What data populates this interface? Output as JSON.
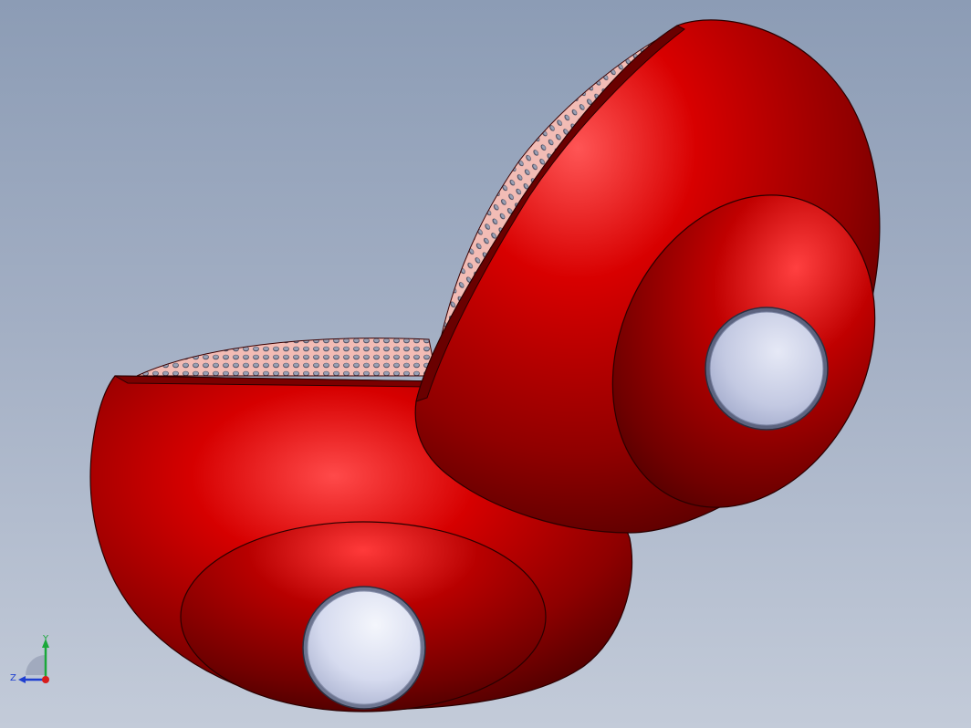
{
  "viewport": {
    "title": "",
    "background_top": "#8c9cb5",
    "background_bottom": "#c3cbd9"
  },
  "model": {
    "part_color": "#c40000",
    "perforation_color": "#f0b6b0",
    "port_color": "#cdd3ea"
  },
  "triad": {
    "y_label": "Y",
    "z_label": "Z",
    "y_color": "#1aa83a",
    "z_color": "#1f3fd0",
    "x_color": "#d81b1b"
  }
}
